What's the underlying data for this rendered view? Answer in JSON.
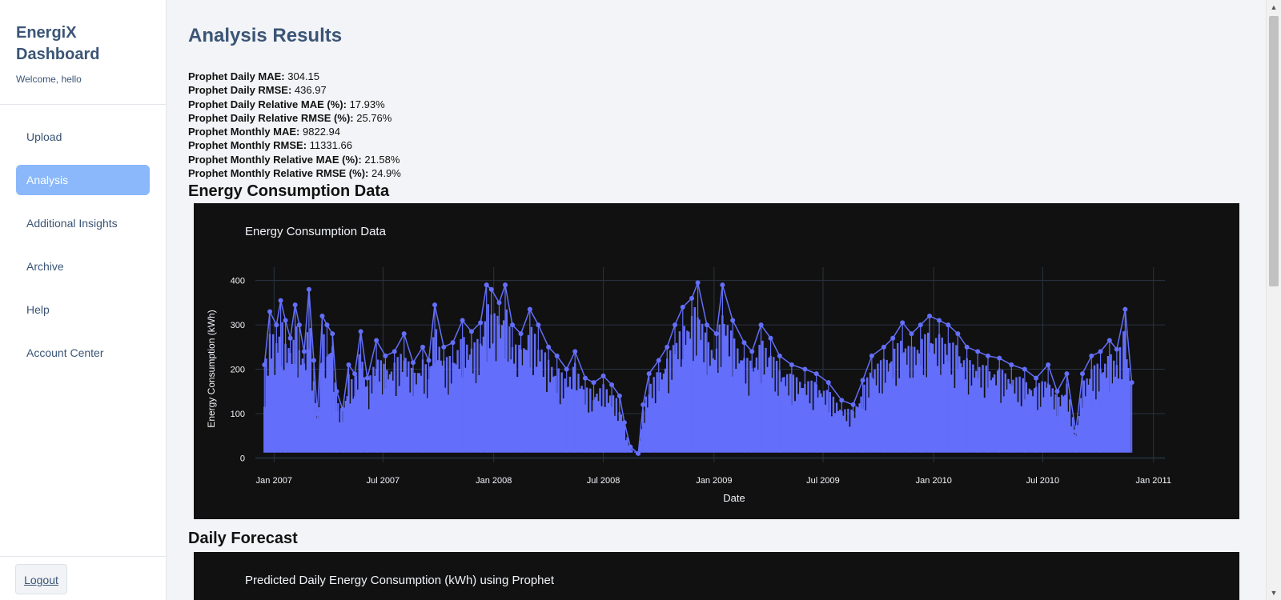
{
  "sidebar": {
    "brand_title": "EnergiX Dashboard",
    "welcome": "Welcome, hello",
    "items": [
      {
        "label": "Upload"
      },
      {
        "label": "Analysis"
      },
      {
        "label": "Additional Insights"
      },
      {
        "label": "Archive"
      },
      {
        "label": "Help"
      },
      {
        "label": "Account Center"
      }
    ],
    "active_item": "Analysis",
    "logout_label": "Logout"
  },
  "main": {
    "title": "Analysis Results",
    "metrics": [
      {
        "label": "Prophet Daily MAE:",
        "value": "304.15"
      },
      {
        "label": "Prophet Daily RMSE:",
        "value": "436.97"
      },
      {
        "label": "Prophet Daily Relative MAE (%):",
        "value": "17.93%"
      },
      {
        "label": "Prophet Daily Relative RMSE (%):",
        "value": "25.76%"
      },
      {
        "label": "Prophet Monthly MAE:",
        "value": "9822.94"
      },
      {
        "label": "Prophet Monthly RMSE:",
        "value": "11331.66"
      },
      {
        "label": "Prophet Monthly Relative MAE (%):",
        "value": "21.58%"
      },
      {
        "label": "Prophet Monthly Relative RMSE (%):",
        "value": "24.9%"
      }
    ],
    "energy_section_title": "Energy Consumption Data",
    "daily_section_title": "Daily Forecast",
    "daily_chart_title": "Predicted Daily Energy Consumption (kWh) using Prophet"
  },
  "colors": {
    "accent": "#8ab8fb",
    "brand_text": "#3b5576",
    "chart_bg": "#111111",
    "series": "#636efa",
    "grid": "#283442"
  },
  "chart_data": {
    "type": "line",
    "title": "Energy Consumption Data",
    "xlabel": "Date",
    "ylabel": "Energy Consumption (kWh)",
    "x_ticks": [
      "Jan 2007",
      "Jul 2007",
      "Jan 2008",
      "Jul 2008",
      "Jan 2009",
      "Jul 2009",
      "Jan 2010",
      "Jul 2010",
      "Jan 2011"
    ],
    "y_ticks": [
      0,
      100,
      200,
      300,
      400
    ],
    "xlim": [
      "2006-12-01",
      "2011-01-20"
    ],
    "ylim": [
      -10,
      430
    ],
    "markers": true,
    "grid": true,
    "series": [
      {
        "color": "#636efa",
        "points": [
          [
            "2006-12-16",
            210
          ],
          [
            "2006-12-25",
            330
          ],
          [
            "2007-01-05",
            300
          ],
          [
            "2007-01-12",
            355
          ],
          [
            "2007-01-20",
            310
          ],
          [
            "2007-01-28",
            270
          ],
          [
            "2007-02-05",
            345
          ],
          [
            "2007-02-12",
            300
          ],
          [
            "2007-02-20",
            240
          ],
          [
            "2007-02-28",
            380
          ],
          [
            "2007-03-08",
            220
          ],
          [
            "2007-03-14",
            100
          ],
          [
            "2007-03-22",
            320
          ],
          [
            "2007-03-30",
            300
          ],
          [
            "2007-04-08",
            280
          ],
          [
            "2007-04-15",
            150
          ],
          [
            "2007-04-25",
            110
          ],
          [
            "2007-05-05",
            210
          ],
          [
            "2007-05-15",
            190
          ],
          [
            "2007-05-25",
            285
          ],
          [
            "2007-06-05",
            180
          ],
          [
            "2007-06-20",
            265
          ],
          [
            "2007-07-05",
            230
          ],
          [
            "2007-07-20",
            240
          ],
          [
            "2007-08-05",
            280
          ],
          [
            "2007-08-20",
            215
          ],
          [
            "2007-09-05",
            250
          ],
          [
            "2007-09-15",
            220
          ],
          [
            "2007-09-25",
            345
          ],
          [
            "2007-10-10",
            250
          ],
          [
            "2007-10-25",
            260
          ],
          [
            "2007-11-10",
            310
          ],
          [
            "2007-11-25",
            285
          ],
          [
            "2007-12-10",
            305
          ],
          [
            "2007-12-20",
            390
          ],
          [
            "2007-12-28",
            380
          ],
          [
            "2008-01-10",
            350
          ],
          [
            "2008-01-20",
            390
          ],
          [
            "2008-02-01",
            300
          ],
          [
            "2008-02-15",
            280
          ],
          [
            "2008-03-01",
            335
          ],
          [
            "2008-03-15",
            300
          ],
          [
            "2008-04-01",
            250
          ],
          [
            "2008-04-15",
            230
          ],
          [
            "2008-05-01",
            200
          ],
          [
            "2008-05-15",
            240
          ],
          [
            "2008-06-01",
            180
          ],
          [
            "2008-06-15",
            170
          ],
          [
            "2008-07-01",
            185
          ],
          [
            "2008-07-15",
            165
          ],
          [
            "2008-07-28",
            140
          ],
          [
            "2008-08-05",
            80
          ],
          [
            "2008-08-15",
            25
          ],
          [
            "2008-08-28",
            10
          ],
          [
            "2008-09-05",
            120
          ],
          [
            "2008-09-15",
            190
          ],
          [
            "2008-10-01",
            220
          ],
          [
            "2008-10-15",
            250
          ],
          [
            "2008-10-28",
            300
          ],
          [
            "2008-11-10",
            340
          ],
          [
            "2008-11-25",
            360
          ],
          [
            "2008-12-05",
            395
          ],
          [
            "2008-12-20",
            300
          ],
          [
            "2009-01-05",
            280
          ],
          [
            "2009-01-15",
            390
          ],
          [
            "2009-02-01",
            310
          ],
          [
            "2009-02-20",
            260
          ],
          [
            "2009-03-05",
            240
          ],
          [
            "2009-03-20",
            300
          ],
          [
            "2009-04-05",
            270
          ],
          [
            "2009-04-20",
            230
          ],
          [
            "2009-05-10",
            210
          ],
          [
            "2009-06-01",
            200
          ],
          [
            "2009-06-20",
            190
          ],
          [
            "2009-07-10",
            170
          ],
          [
            "2009-08-01",
            130
          ],
          [
            "2009-08-20",
            120
          ],
          [
            "2009-09-05",
            175
          ],
          [
            "2009-09-20",
            230
          ],
          [
            "2009-10-10",
            250
          ],
          [
            "2009-10-25",
            270
          ],
          [
            "2009-11-10",
            305
          ],
          [
            "2009-11-25",
            280
          ],
          [
            "2009-12-10",
            300
          ],
          [
            "2009-12-25",
            320
          ],
          [
            "2010-01-10",
            310
          ],
          [
            "2010-01-25",
            300
          ],
          [
            "2010-02-10",
            280
          ],
          [
            "2010-02-25",
            250
          ],
          [
            "2010-03-15",
            240
          ],
          [
            "2010-04-01",
            230
          ],
          [
            "2010-04-20",
            225
          ],
          [
            "2010-05-10",
            210
          ],
          [
            "2010-06-01",
            200
          ],
          [
            "2010-06-20",
            180
          ],
          [
            "2010-07-10",
            210
          ],
          [
            "2010-07-25",
            150
          ],
          [
            "2010-08-10",
            190
          ],
          [
            "2010-08-25",
            60
          ],
          [
            "2010-09-05",
            190
          ],
          [
            "2010-09-20",
            230
          ],
          [
            "2010-10-05",
            240
          ],
          [
            "2010-10-20",
            265
          ],
          [
            "2010-11-01",
            245
          ],
          [
            "2010-11-15",
            335
          ],
          [
            "2010-11-26",
            170
          ]
        ]
      }
    ]
  }
}
